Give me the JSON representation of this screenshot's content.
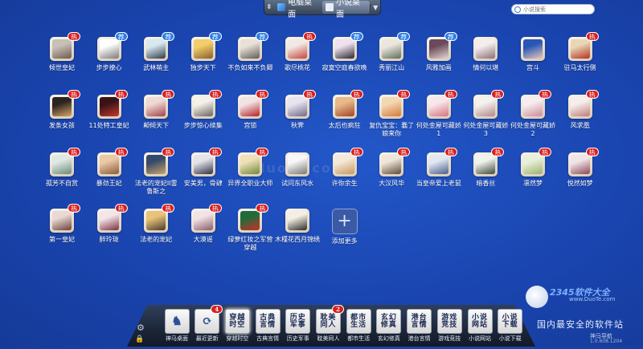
{
  "top_switch": {
    "tab_pc": "电脑桌面",
    "tab_novel": "小说桌面"
  },
  "search": {
    "placeholder": "小说搜索"
  },
  "apps": [
    {
      "label": "倾世皇妃",
      "badge": "热",
      "badge_type": "red",
      "art": [
        "#c7c0b8",
        "#6e5a4d"
      ]
    },
    {
      "label": "步步撩心",
      "badge": "荐",
      "badge_type": "blue",
      "art": [
        "#ffffff",
        "#7a7a7a"
      ]
    },
    {
      "label": "武林萌主",
      "badge": "荐",
      "badge_type": "blue",
      "art": [
        "#d7e8f0",
        "#2f3b44"
      ]
    },
    {
      "label": "独步天下",
      "badge": "荐",
      "badge_type": "blue",
      "art": [
        "#f1cf6a",
        "#8b5d2c"
      ]
    },
    {
      "label": "不负如来不负卿",
      "badge": "荐",
      "badge_type": "blue",
      "art": [
        "#e9e1d6",
        "#5e5b59"
      ]
    },
    {
      "label": "歌尽桃花",
      "badge": "热",
      "badge_type": "red",
      "art": [
        "#f1e9e4",
        "#c7443d"
      ]
    },
    {
      "label": "寂寞空庭春欲晚",
      "badge": "荐",
      "badge_type": "blue",
      "art": [
        "#efe1ee",
        "#2a2630"
      ]
    },
    {
      "label": "秀丽江山",
      "badge": "荐",
      "badge_type": "blue",
      "art": [
        "#ece7de",
        "#5d6d58"
      ]
    },
    {
      "label": "风雅加画",
      "badge": "荐",
      "badge_type": "blue",
      "art": [
        "#6a4a5a",
        "#e2d6d2"
      ]
    },
    {
      "label": "情何以堪",
      "badge": "",
      "badge_type": "",
      "art": [
        "#f4eded",
        "#8a6f76"
      ]
    },
    {
      "label": "宫斗",
      "badge": "",
      "badge_type": "",
      "art": [
        "#2856b8",
        "#e7c7b6"
      ]
    },
    {
      "label": "驻马太行侧",
      "badge": "热",
      "badge_type": "red",
      "art": [
        "#e9d7b4",
        "#b23024"
      ]
    },
    {
      "label": "发条女孩",
      "badge": "热",
      "badge_type": "red",
      "art": [
        "#2b2320",
        "#d6a56a"
      ]
    },
    {
      "label": "11处特工皇妃",
      "badge": "热",
      "badge_type": "red",
      "art": [
        "#3a1316",
        "#c33a2f"
      ]
    },
    {
      "label": "颠倾天下",
      "badge": "热",
      "badge_type": "red",
      "art": [
        "#efd9d4",
        "#a5404f"
      ]
    },
    {
      "label": "步步惊心续集",
      "badge": "热",
      "badge_type": "red",
      "art": [
        "#f4f1ea",
        "#6a6560"
      ]
    },
    {
      "label": "宫锁",
      "badge": "热",
      "badge_type": "red",
      "art": [
        "#f1e3e3",
        "#b41f2a"
      ]
    },
    {
      "label": "秋霁",
      "badge": "热",
      "badge_type": "red",
      "art": [
        "#e8e4ef",
        "#6f6a8a"
      ]
    },
    {
      "label": "太后也疯狂",
      "badge": "热",
      "badge_type": "red",
      "art": [
        "#e8b98a",
        "#a2442a"
      ]
    },
    {
      "label": "复仇宝宝：蠢了娘来你",
      "badge": "热",
      "badge_type": "red",
      "art": [
        "#f3d8b2",
        "#d47a3a"
      ]
    },
    {
      "label": "何处金屋可藏娇1",
      "badge": "热",
      "badge_type": "red",
      "art": [
        "#f7e7ea",
        "#d6727f"
      ]
    },
    {
      "label": "何处金屋可藏娇3",
      "badge": "热",
      "badge_type": "red",
      "art": [
        "#f4f1ef",
        "#b08a8a"
      ]
    },
    {
      "label": "何处金屋可藏娇2",
      "badge": "热",
      "badge_type": "red",
      "art": [
        "#f7ecee",
        "#cc8c99"
      ]
    },
    {
      "label": "风求凰",
      "badge": "热",
      "badge_type": "red",
      "art": [
        "#f6eeea",
        "#bf7b7b"
      ]
    },
    {
      "label": "孤芳不自赏",
      "badge": "热",
      "badge_type": "red",
      "art": [
        "#dfe8e3",
        "#6a8a7a"
      ]
    },
    {
      "label": "暴劲王妃",
      "badge": "热",
      "badge_type": "red",
      "art": [
        "#e9c9a6",
        "#8a5a3a"
      ]
    },
    {
      "label": "法老的宠妃II雷鲁斯之",
      "badge": "热",
      "badge_type": "red",
      "art": [
        "#35496a",
        "#c9a46a"
      ]
    },
    {
      "label": "安美男，骨肆",
      "badge": "热",
      "badge_type": "red",
      "art": [
        "#e4e2ea",
        "#2c3140"
      ]
    },
    {
      "label": "异界全职业大师",
      "badge": "热",
      "badge_type": "red",
      "art": [
        "#f0e0b8",
        "#6e8a3a"
      ]
    },
    {
      "label": "试问东风水",
      "badge": "",
      "badge_type": "",
      "art": [
        "#f7f7f7",
        "#777777"
      ]
    },
    {
      "label": "许你余生",
      "badge": "热",
      "badge_type": "red",
      "art": [
        "#f4e8d8",
        "#c79a5e"
      ]
    },
    {
      "label": "大汉风华",
      "badge": "热",
      "badge_type": "red",
      "art": [
        "#efe6d7",
        "#5d4a3a"
      ]
    },
    {
      "label": "当皇帝爱上老鼠",
      "badge": "热",
      "badge_type": "red",
      "art": [
        "#e1e8f2",
        "#4a5d8a"
      ]
    },
    {
      "label": "暗香丝",
      "badge": "热",
      "badge_type": "red",
      "art": [
        "#f2f2ec",
        "#3c4a3c"
      ]
    },
    {
      "label": "凛然梦",
      "badge": "热",
      "badge_type": "red",
      "art": [
        "#e9f0da",
        "#9ab26a"
      ]
    },
    {
      "label": "悦然如梦",
      "badge": "热",
      "badge_type": "red",
      "art": [
        "#f1e4e7",
        "#8a4a5a"
      ]
    },
    {
      "label": "第一皇妃",
      "badge": "热",
      "badge_type": "red",
      "art": [
        "#e9d9d2",
        "#6b3f3a"
      ]
    },
    {
      "label": "醉玲珑",
      "badge": "热",
      "badge_type": "red",
      "art": [
        "#f3e6e8",
        "#7a2f3f"
      ]
    },
    {
      "label": "法老的宠妃",
      "badge": "热",
      "badge_type": "red",
      "art": [
        "#e9c37a",
        "#4a3a2a"
      ]
    },
    {
      "label": "大漠谣",
      "badge": "热",
      "badge_type": "red",
      "art": [
        "#f1e3e6",
        "#8a5a6a"
      ]
    },
    {
      "label": "绿萝红妆之军营穿越",
      "badge": "热",
      "badge_type": "red",
      "art": [
        "#1f6b3a",
        "#c8302a"
      ]
    },
    {
      "label": "木槿花西月锦绣",
      "badge": "",
      "badge_type": "",
      "art": [
        "#f4efe2",
        "#2a2a2a"
      ]
    }
  ],
  "add_more": {
    "label": "添加更多",
    "icon": "plus-icon"
  },
  "dock": [
    {
      "label": "神马桌面",
      "tile": "",
      "icon": "horse-icon",
      "badge": ""
    },
    {
      "label": "最近更新",
      "tile": "",
      "icon": "refresh-icon",
      "badge": "4"
    },
    {
      "label": "穿越时空",
      "tile": "穿越时空",
      "icon": "",
      "badge": ""
    },
    {
      "label": "古典言情",
      "tile": "古典言情",
      "icon": "",
      "badge": ""
    },
    {
      "label": "历史军事",
      "tile": "历史军事",
      "icon": "",
      "badge": ""
    },
    {
      "label": "耽美同人",
      "tile": "耽美同人",
      "icon": "",
      "badge": "2"
    },
    {
      "label": "都市生活",
      "tile": "都市生活",
      "icon": "",
      "badge": ""
    },
    {
      "label": "玄幻修真",
      "tile": "玄幻修真",
      "icon": "",
      "badge": ""
    },
    {
      "label": "港台言情",
      "tile": "港台言情",
      "icon": "",
      "badge": ""
    },
    {
      "label": "游戏竞技",
      "tile": "游戏竞技",
      "icon": "",
      "badge": ""
    },
    {
      "label": "小说网站",
      "tile": "小说网站",
      "icon": "",
      "badge": ""
    },
    {
      "label": "小说下载",
      "tile": "小说下载",
      "icon": "",
      "badge": ""
    }
  ],
  "watermark": {
    "brand": "2345软件大全",
    "site": "www.DuoTe.com",
    "slogan": "国内最安全的软件站",
    "app_name": "神马导航",
    "version": "1.0.608.1204"
  },
  "center_watermark": "duote.com",
  "colors": {
    "desktop_bg": "#1a45b0",
    "hot_badge": "#d81e1e",
    "recommend_badge": "#2a7ee6"
  }
}
